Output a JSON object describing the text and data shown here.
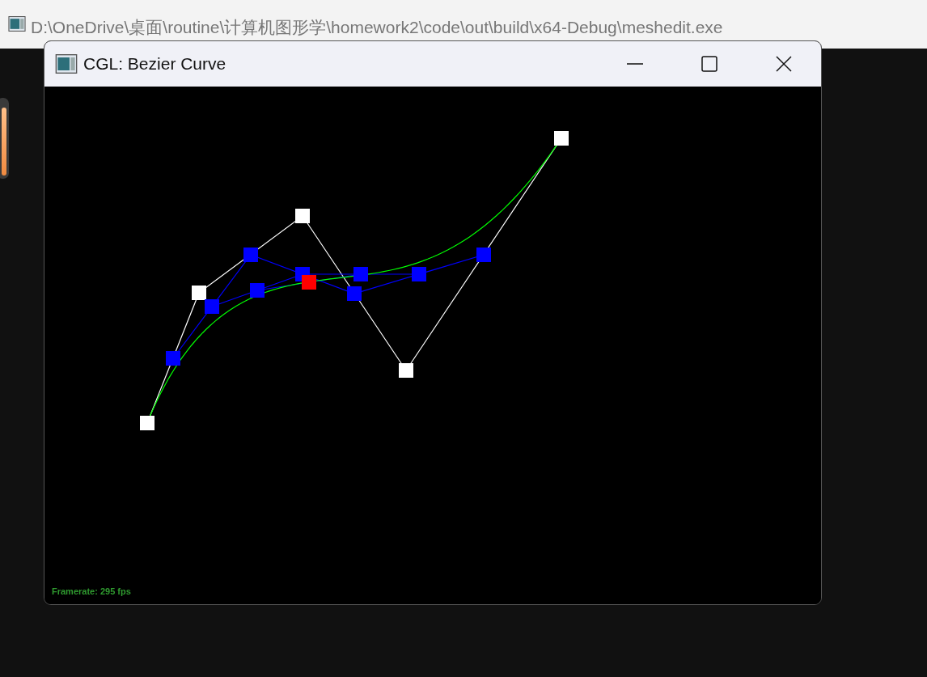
{
  "console_window": {
    "title": "D:\\OneDrive\\桌面\\routine\\计算机图形学\\homework2\\code\\out\\build\\x64-Debug\\meshedit.exe"
  },
  "window": {
    "title": "CGL: Bezier Curve",
    "framerate": "Framerate: 295 fps"
  }
}
